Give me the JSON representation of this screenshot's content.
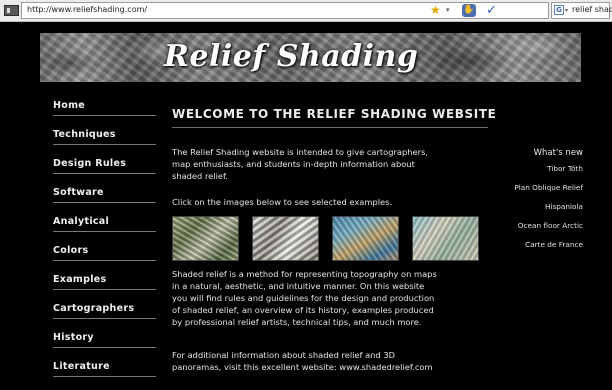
{
  "browser": {
    "url": "http://www.reliefshading.com/",
    "search_query": "relief shading",
    "icons": [
      "site-icon",
      "star-icon",
      "dropdown-icon",
      "hand-icon",
      "checkmark-icon",
      "google-icon"
    ]
  },
  "banner": {
    "title": "Relief Shading"
  },
  "nav": {
    "items": [
      {
        "label": "Home"
      },
      {
        "label": "Techniques"
      },
      {
        "label": "Design Rules"
      },
      {
        "label": "Software"
      },
      {
        "label": "Analytical"
      },
      {
        "label": "Colors"
      },
      {
        "label": "Examples"
      },
      {
        "label": "Cartographers"
      },
      {
        "label": "History"
      },
      {
        "label": "Literature"
      }
    ]
  },
  "main": {
    "heading": "WELCOME TO THE RELIEF SHADING WEBSITE",
    "paragraphs": [
      "The Relief Shading website is intended to give cartographers,\nmap enthusiasts, and students in-depth information about\nshaded relief.",
      "Click on the images below to see selected examples.",
      "Shaded relief is a method for representing topography on maps\nin a natural, aesthetic, and intuitive manner. On this website\nyou will find rules and guidelines for the design and production\nof shaded relief, an overview of its history, examples produced\nby professional relief artists, technical tips, and much more.",
      "For additional information about shaded relief and 3D\npanoramas, visit this excellent website: www.shadedrelief.com"
    ]
  },
  "whats_new": {
    "heading": "What's new",
    "links": [
      "Tibor Tóth",
      "Plan Oblique Relief",
      "Hispaniola",
      "Ocean floor Arctic",
      "Carte de France"
    ]
  },
  "colors": {
    "background": "#000000",
    "text": "#e4e4e4",
    "nav_rule": "#7a7a7a"
  }
}
